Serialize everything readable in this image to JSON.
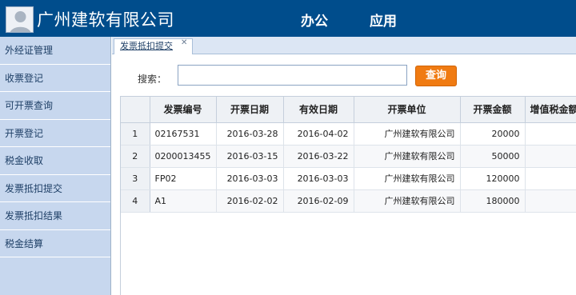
{
  "header": {
    "company": "广州建软有限公司",
    "nav": [
      "办公",
      "应用"
    ]
  },
  "sidebar": {
    "items": [
      {
        "label": "外经证管理"
      },
      {
        "label": "收票登记"
      },
      {
        "label": "可开票查询"
      },
      {
        "label": "开票登记"
      },
      {
        "label": "税金收取"
      },
      {
        "label": "发票抵扣提交"
      },
      {
        "label": "发票抵扣结果"
      },
      {
        "label": "税金结算"
      }
    ]
  },
  "tabs": [
    {
      "label": "发票抵扣提交",
      "close": "✕"
    }
  ],
  "search": {
    "label": "搜索：",
    "value": "",
    "placeholder": "",
    "button": "查询"
  },
  "table": {
    "columns": [
      "发票编号",
      "开票日期",
      "有效日期",
      "开票单位",
      "开票金额",
      "增值税金额"
    ],
    "rows": [
      {
        "num": "1",
        "code": "02167531",
        "issue_date": "2016-03-28",
        "valid_date": "2016-04-02",
        "unit": "广州建软有限公司",
        "amount": "20000",
        "vat": ""
      },
      {
        "num": "2",
        "code": "0200013455",
        "issue_date": "2016-03-15",
        "valid_date": "2016-03-22",
        "unit": "广州建软有限公司",
        "amount": "50000",
        "vat": ""
      },
      {
        "num": "3",
        "code": "FP02",
        "issue_date": "2016-03-03",
        "valid_date": "2016-03-03",
        "unit": "广州建软有限公司",
        "amount": "120000",
        "vat": ""
      },
      {
        "num": "4",
        "code": "A1",
        "issue_date": "2016-02-02",
        "valid_date": "2016-02-09",
        "unit": "广州建软有限公司",
        "amount": "180000",
        "vat": ""
      }
    ]
  },
  "colors": {
    "header_bg": "#004d8c",
    "sidebar_bg": "#c7d7ee",
    "query_button": "#f07b12"
  },
  "icons": {
    "avatar": "user-avatar-icon",
    "tab_close": "close-icon"
  }
}
